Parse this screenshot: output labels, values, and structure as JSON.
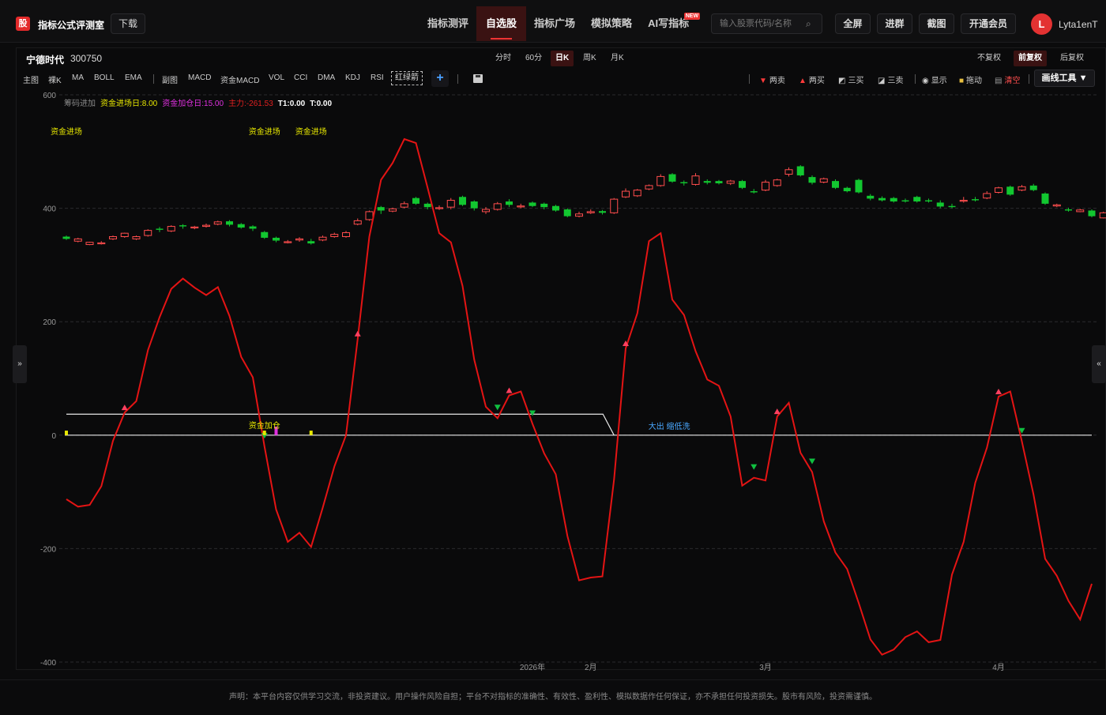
{
  "header": {
    "logo_char": "股",
    "title": "指标公式评测室",
    "download": "下载",
    "nav": [
      {
        "label": "指标测评",
        "active": false,
        "badge": ""
      },
      {
        "label": "自选股",
        "active": true,
        "badge": ""
      },
      {
        "label": "指标广场",
        "active": false,
        "badge": ""
      },
      {
        "label": "模拟策略",
        "active": false,
        "badge": ""
      },
      {
        "label": "AI写指标",
        "active": false,
        "badge": "NEW"
      }
    ],
    "search_placeholder": "输入股票代码/名称",
    "buttons": [
      "全屏",
      "进群",
      "截图",
      "开通会员"
    ],
    "avatar_letter": "L",
    "username": "Lyta1enT"
  },
  "stock": {
    "name": "宁德时代",
    "code": "300750"
  },
  "periods": [
    "分时",
    "60分",
    "日K",
    "周K",
    "月K"
  ],
  "active_period": "日K",
  "adjust": [
    "不复权",
    "前复权",
    "后复权"
  ],
  "active_adjust": "前复权",
  "toolbar_left": [
    "主图",
    "裸K",
    "MA",
    "BOLL",
    "EMA",
    "副图",
    "MACD",
    "资金MACD",
    "VOL",
    "CCI",
    "DMA",
    "KDJ",
    "RSI"
  ],
  "toolbar_boxed": "红绿箭",
  "toolbar_right": {
    "sell2": "两卖",
    "buy2": "两买",
    "buy3": "三买",
    "sell3": "三卖",
    "show": "显示",
    "drag": "拖动",
    "clear": "清空",
    "draw_tools": "画线工具 ▼"
  },
  "legend": {
    "name": "筹码进加",
    "items": [
      {
        "text": "资金进场日:8.00",
        "color": "#e8e800"
      },
      {
        "text": "资金加仓日:15.00",
        "color": "#e030e0"
      },
      {
        "text": "主力:-261.53",
        "color": "#e02020"
      },
      {
        "text": "T1:0.00",
        "color": "#ffffff"
      },
      {
        "text": "T:0.00",
        "color": "#ffffff"
      }
    ]
  },
  "chart_data": {
    "type": "line",
    "ylim": [
      -400,
      600
    ],
    "yticks": [
      600,
      400,
      200,
      0,
      -200,
      -400
    ],
    "x_labels": [
      {
        "label": "2026年",
        "i": 40
      },
      {
        "label": "2月",
        "i": 45
      },
      {
        "label": "3月",
        "i": 60
      },
      {
        "label": "4月",
        "i": 80
      }
    ],
    "candles": [
      [
        350,
        346,
        352,
        344
      ],
      [
        342,
        346,
        348,
        340
      ],
      [
        336,
        340,
        341,
        335
      ],
      [
        338,
        339,
        342,
        336
      ],
      [
        346,
        350,
        352,
        344
      ],
      [
        350,
        356,
        357,
        348
      ],
      [
        346,
        350,
        352,
        344
      ],
      [
        352,
        361,
        363,
        350
      ],
      [
        364,
        362,
        367,
        358
      ],
      [
        360,
        368,
        370,
        358
      ],
      [
        370,
        368,
        372,
        364
      ],
      [
        366,
        367,
        369,
        363
      ],
      [
        368,
        370,
        373,
        366
      ],
      [
        372,
        376,
        378,
        370
      ],
      [
        377,
        371,
        379,
        368
      ],
      [
        372,
        366,
        374,
        364
      ],
      [
        368,
        364,
        370,
        360
      ],
      [
        358,
        348,
        360,
        346
      ],
      [
        348,
        343,
        350,
        340
      ],
      [
        340,
        341,
        344,
        338
      ],
      [
        344,
        346,
        349,
        341
      ],
      [
        342,
        338,
        346,
        336
      ],
      [
        344,
        349,
        352,
        342
      ],
      [
        350,
        354,
        357,
        348
      ],
      [
        350,
        357,
        360,
        348
      ],
      [
        372,
        378,
        382,
        370
      ],
      [
        380,
        394,
        396,
        378
      ],
      [
        402,
        396,
        404,
        390
      ],
      [
        395,
        399,
        401,
        393
      ],
      [
        402,
        408,
        412,
        400
      ],
      [
        418,
        408,
        420,
        406
      ],
      [
        408,
        402,
        410,
        398
      ],
      [
        400,
        401,
        405,
        397
      ],
      [
        402,
        414,
        418,
        398
      ],
      [
        420,
        406,
        422,
        404
      ],
      [
        412,
        400,
        414,
        396
      ],
      [
        394,
        398,
        402,
        390
      ],
      [
        398,
        408,
        411,
        396
      ],
      [
        412,
        406,
        416,
        402
      ],
      [
        404,
        404,
        408,
        400
      ],
      [
        410,
        404,
        412,
        402
      ],
      [
        408,
        402,
        410,
        398
      ],
      [
        404,
        396,
        406,
        394
      ],
      [
        398,
        386,
        400,
        384
      ],
      [
        386,
        390,
        394,
        384
      ],
      [
        392,
        394,
        398,
        390
      ],
      [
        395,
        392,
        397,
        389
      ],
      [
        392,
        416,
        418,
        390
      ],
      [
        420,
        430,
        435,
        418
      ],
      [
        422,
        432,
        434,
        420
      ],
      [
        434,
        440,
        442,
        432
      ],
      [
        440,
        456,
        460,
        438
      ],
      [
        460,
        447,
        462,
        445
      ],
      [
        446,
        444,
        449,
        440
      ],
      [
        442,
        457,
        462,
        440
      ],
      [
        448,
        445,
        451,
        442
      ],
      [
        448,
        444,
        450,
        442
      ],
      [
        444,
        448,
        450,
        441
      ],
      [
        448,
        436,
        450,
        434
      ],
      [
        430,
        428,
        434,
        426
      ],
      [
        432,
        446,
        450,
        430
      ],
      [
        440,
        450,
        452,
        438
      ],
      [
        460,
        468,
        472,
        456
      ],
      [
        474,
        458,
        476,
        456
      ],
      [
        455,
        445,
        458,
        442
      ],
      [
        446,
        452,
        454,
        444
      ],
      [
        448,
        436,
        451,
        434
      ],
      [
        436,
        430,
        438,
        428
      ],
      [
        450,
        428,
        452,
        426
      ],
      [
        422,
        417,
        425,
        414
      ],
      [
        418,
        414,
        421,
        412
      ],
      [
        418,
        412,
        420,
        410
      ],
      [
        414,
        412,
        417,
        410
      ],
      [
        420,
        412,
        422,
        410
      ],
      [
        414,
        412,
        417,
        410
      ],
      [
        410,
        403,
        414,
        400
      ],
      [
        404,
        402,
        408,
        400
      ],
      [
        414,
        414,
        420,
        410
      ],
      [
        416,
        414,
        420,
        412
      ],
      [
        418,
        426,
        430,
        416
      ],
      [
        428,
        436,
        438,
        426
      ],
      [
        438,
        424,
        440,
        422
      ],
      [
        432,
        438,
        441,
        430
      ],
      [
        440,
        432,
        443,
        430
      ],
      [
        426,
        408,
        428,
        406
      ],
      [
        404,
        406,
        408,
        402
      ],
      [
        398,
        396,
        401,
        394
      ],
      [
        394,
        397,
        399,
        393
      ],
      [
        396,
        386,
        398,
        384
      ],
      [
        383,
        392,
        394,
        382
      ],
      [
        390,
        396,
        398,
        388
      ]
    ],
    "main_line": [
      -113,
      -126,
      -123,
      -90,
      -10,
      40,
      60,
      150,
      208,
      258,
      276,
      260,
      247,
      261,
      210,
      138,
      102,
      -20,
      -131,
      -188,
      -172,
      -197,
      -128,
      -55,
      0,
      170,
      350,
      450,
      480,
      522,
      515,
      436,
      356,
      340,
      263,
      133,
      50,
      30,
      70,
      77,
      20,
      -32,
      -69,
      -178,
      -256,
      -251,
      -249,
      -78,
      153,
      215,
      342,
      356,
      239,
      212,
      148,
      98,
      87,
      33,
      -89,
      -75,
      -80,
      33,
      57,
      -31,
      -65,
      -152,
      -207,
      -236,
      -296,
      -360,
      -387,
      -378,
      -356,
      -346,
      -365,
      -361,
      -246,
      -188,
      -84,
      -22,
      68,
      77,
      -11,
      -105,
      -218,
      -248,
      -292,
      -325,
      -262
    ],
    "ref_line": {
      "level": 37,
      "end_i": 47
    },
    "buy_markers": [
      5,
      25,
      38,
      48,
      61,
      80
    ],
    "sell_markers": [
      17,
      37,
      40,
      59,
      64,
      82
    ],
    "events": [
      {
        "text": "资金进场",
        "i": 0,
        "color": "#e8e800"
      },
      {
        "text": "资金进场",
        "i": 17,
        "color": "#e8e800"
      },
      {
        "text": "资金进场",
        "i": 21,
        "color": "#e8e800"
      },
      {
        "text": "资金加仓",
        "i": 17,
        "color": "#e8e800"
      },
      {
        "text": "大出 缩低洗",
        "i": 49,
        "color": "#4aa8ff"
      }
    ],
    "bars": [
      {
        "i": 0,
        "value": 8,
        "color": "#e8e800"
      },
      {
        "i": 17,
        "value": 8,
        "color": "#e8e800"
      },
      {
        "i": 18,
        "value": 15,
        "color": "#e030e0"
      },
      {
        "i": 21,
        "value": 8,
        "color": "#e8e800"
      }
    ]
  },
  "colors": {
    "up": "#ff4d4d",
    "down": "#12c730",
    "line": "#e41414",
    "accent": "#e33232"
  },
  "side_left": "»",
  "side_right": "«",
  "footer": "声明：本平台内容仅供学习交流，非投资建议。用户操作风险自担；平台不对指标的准确性、有效性、盈利性、模拟数据作任何保证，亦不承担任何投资损失。股市有风险，投资需谨慎。"
}
